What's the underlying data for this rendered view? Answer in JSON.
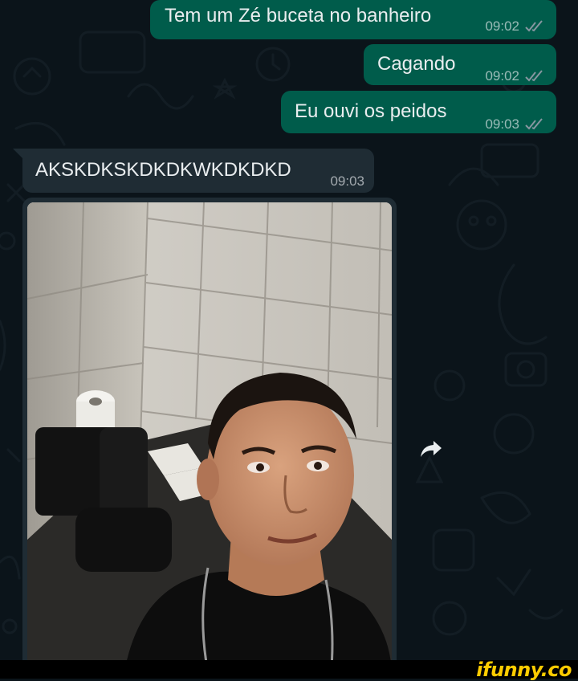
{
  "messages": [
    {
      "direction": "outgoing",
      "text": "Tem um Zé buceta no banheiro",
      "time": "09:02",
      "status": "read"
    },
    {
      "direction": "outgoing",
      "text": "Cagando",
      "time": "09:02",
      "status": "read"
    },
    {
      "direction": "outgoing",
      "text": "Eu ouvi os peidos",
      "time": "09:03",
      "status": "read"
    },
    {
      "direction": "incoming",
      "text": "AKSKDKSKDKDKWKDKDKD",
      "time": "09:03"
    }
  ],
  "photo_message": {
    "direction": "incoming",
    "icon": "forward-icon"
  },
  "colors": {
    "chat_background": "#0b141a",
    "outgoing_bubble": "#005c4b",
    "incoming_bubble": "#1f2c34",
    "read_ticks": "#8696a0"
  },
  "watermark": {
    "text": "ifunny.co"
  }
}
